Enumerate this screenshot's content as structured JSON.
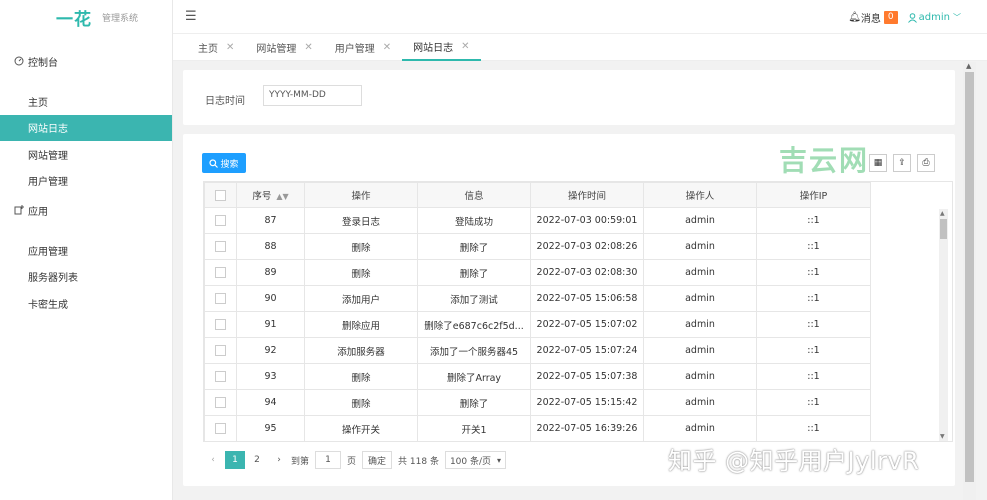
{
  "logo": {
    "brand": "一花",
    "subtitle": "管理系统"
  },
  "sidebar": {
    "groups": [
      {
        "label": "控制台",
        "icon": "dashboard-icon",
        "items": [
          "主页",
          "网站日志",
          "网站管理",
          "用户管理"
        ]
      },
      {
        "label": "应用",
        "icon": "app-icon",
        "items": [
          "应用管理",
          "服务器列表",
          "卡密生成"
        ]
      }
    ],
    "active": "网站日志"
  },
  "header": {
    "messages_label": "消息",
    "messages_count": "0",
    "user": "admin"
  },
  "tabs": [
    {
      "label": "主页",
      "active": false
    },
    {
      "label": "网站管理",
      "active": false
    },
    {
      "label": "用户管理",
      "active": false
    },
    {
      "label": "网站日志",
      "active": true
    }
  ],
  "filter": {
    "label": "日志时间",
    "placeholder": "YYYY-MM-DD"
  },
  "toolbar": {
    "search_label": "搜索"
  },
  "table": {
    "columns": [
      "序号",
      "操作",
      "信息",
      "操作时间",
      "操作人",
      "操作IP"
    ],
    "rows": [
      [
        "87",
        "登录日志",
        "登陆成功",
        "2022-07-03 00:59:01",
        "admin",
        "::1"
      ],
      [
        "88",
        "删除",
        "删除了",
        "2022-07-03 02:08:26",
        "admin",
        "::1"
      ],
      [
        "89",
        "删除",
        "删除了",
        "2022-07-03 02:08:30",
        "admin",
        "::1"
      ],
      [
        "90",
        "添加用户",
        "添加了测试",
        "2022-07-05 15:06:58",
        "admin",
        "::1"
      ],
      [
        "91",
        "删除应用",
        "删除了e687c6c2f5d...",
        "2022-07-05 15:07:02",
        "admin",
        "::1"
      ],
      [
        "92",
        "添加服务器",
        "添加了一个服务器45",
        "2022-07-05 15:07:24",
        "admin",
        "::1"
      ],
      [
        "93",
        "删除",
        "删除了Array",
        "2022-07-05 15:07:38",
        "admin",
        "::1"
      ],
      [
        "94",
        "删除",
        "删除了",
        "2022-07-05 15:15:42",
        "admin",
        "::1"
      ],
      [
        "95",
        "操作开关",
        "开关1",
        "2022-07-05 16:39:26",
        "admin",
        "::1"
      ]
    ]
  },
  "pager": {
    "pages": [
      "1",
      "2"
    ],
    "current": "1",
    "goto_label": "到第",
    "goto_value": "1",
    "page_unit": "页",
    "confirm": "确定",
    "total": "共 118 条",
    "page_size": "100 条/页"
  },
  "watermark": {
    "top": "吉云网",
    "bottom": "知乎 @知乎用户JylrvR"
  },
  "colors": {
    "accent": "#3bb5b0",
    "primary_button": "#1e9fff",
    "badge": "#ff7a2e"
  }
}
